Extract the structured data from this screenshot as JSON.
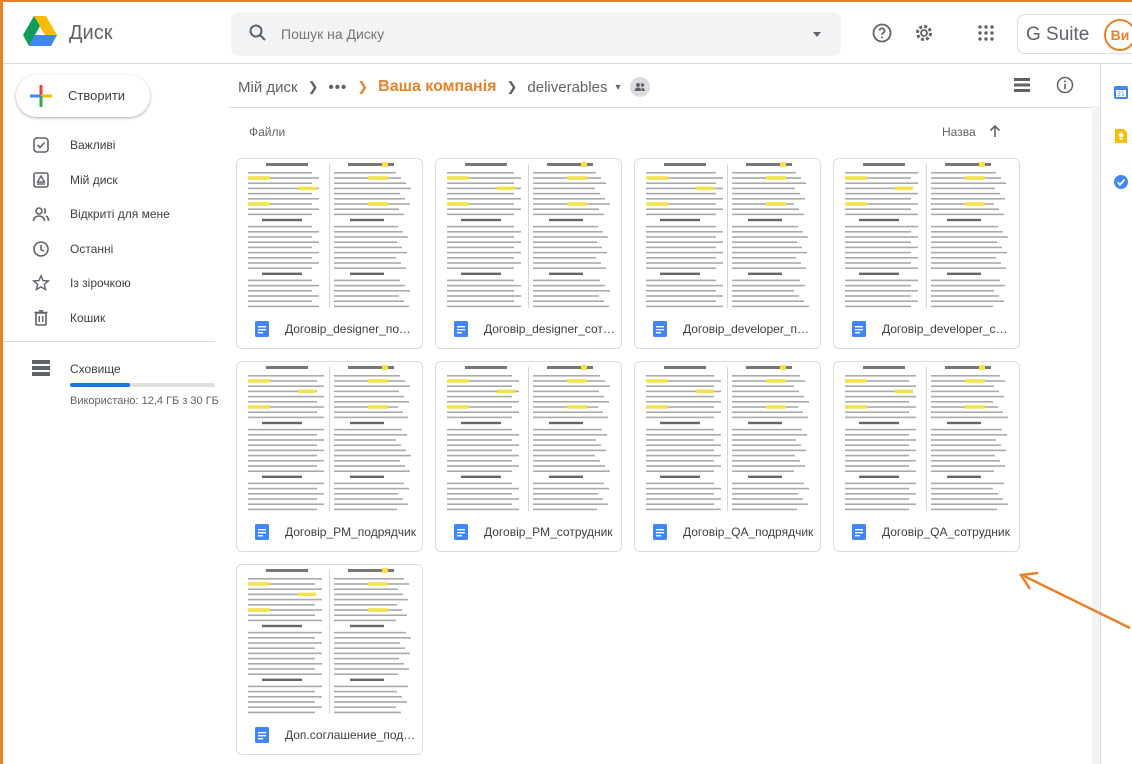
{
  "app": {
    "name": "Диск",
    "brand": "G Suite",
    "avatar_initials": "Ви"
  },
  "search": {
    "placeholder": "Пошук на Диску"
  },
  "colors": {
    "accent": "#e8822a",
    "blue": "#1a73e8",
    "doc_blue": "#4285f4"
  },
  "sidebar": {
    "create_label": "Створити",
    "items": [
      {
        "label": "Важливі",
        "icon": "priority-icon"
      },
      {
        "label": "Мій диск",
        "icon": "my-drive-icon"
      },
      {
        "label": "Відкриті для мене",
        "icon": "shared-with-me-icon"
      },
      {
        "label": "Останні",
        "icon": "recent-icon"
      },
      {
        "label": "Із зірочкою",
        "icon": "star-icon"
      },
      {
        "label": "Кошик",
        "icon": "trash-icon"
      }
    ],
    "storage": {
      "label": "Сховище",
      "used_text": "Використано: 12,4 ГБ з 30 ГБ",
      "used_fraction": 0.413
    }
  },
  "breadcrumb": {
    "root": "Мій диск",
    "ellipsis": "•••",
    "parent": "Ваша компанія",
    "current": "deliverables"
  },
  "main": {
    "section_label": "Файли",
    "sort_label": "Назва",
    "files": [
      {
        "name": "Договір_designer_подрядчик"
      },
      {
        "name": "Договір_designer_сотрудник"
      },
      {
        "name": "Договір_developer_подрядчик"
      },
      {
        "name": "Договір_developer_сотрудник"
      },
      {
        "name": "Договір_PM_подрядчик"
      },
      {
        "name": "Договір_PM_сотрудник"
      },
      {
        "name": "Договір_QA_подрядчик"
      },
      {
        "name": "Договір_QA_сотрудник"
      },
      {
        "name": "Доп.соглашение_подрядчик"
      }
    ]
  }
}
